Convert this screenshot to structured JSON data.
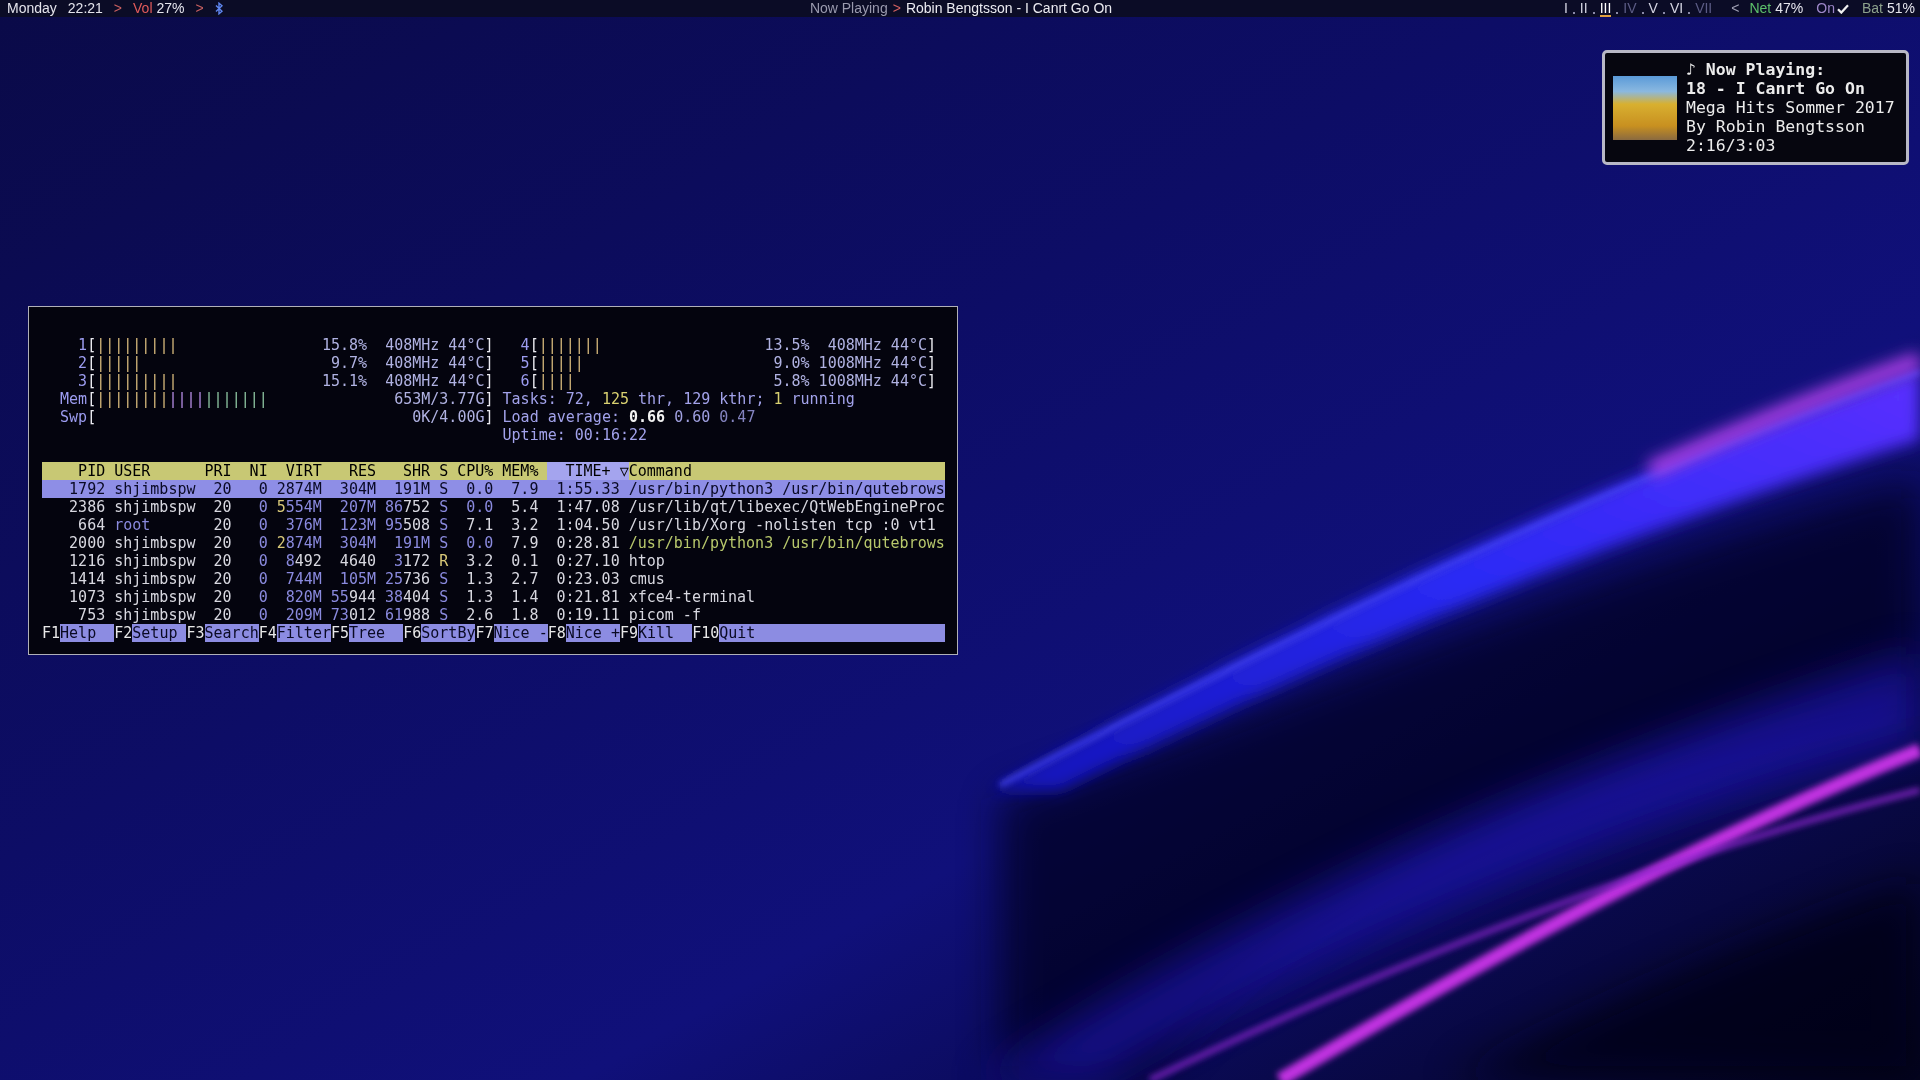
{
  "top_bar": {
    "left": [
      {
        "kind": "day",
        "text": "Monday"
      },
      {
        "kind": "clock",
        "text": "22:21"
      },
      {
        "kind": "separator",
        "text": ">",
        "color": "#c86060"
      },
      {
        "kind": "status",
        "label": "Vol",
        "value": "27%",
        "color": "#e05a5a"
      },
      {
        "kind": "separator",
        "text": ">",
        "color": "#c86060"
      },
      {
        "kind": "bluetooth"
      }
    ],
    "now_playing": {
      "label": "Now Playing",
      "separator": ">",
      "track": "Robin Bengtsson - I Canrt Go On"
    },
    "workspaces": [
      {
        "label": "I",
        "selected": false,
        "occupied": true
      },
      {
        "label": "II",
        "selected": false,
        "occupied": true
      },
      {
        "label": "III",
        "selected": true,
        "occupied": true
      },
      {
        "label": "IV",
        "selected": false,
        "occupied": false
      },
      {
        "label": "V",
        "selected": false,
        "occupied": true
      },
      {
        "label": "VI",
        "selected": false,
        "occupied": true
      },
      {
        "label": "VII",
        "selected": false,
        "occupied": false
      }
    ],
    "right": [
      {
        "kind": "separator",
        "text": "<",
        "color": "#a0a0b4"
      },
      {
        "kind": "status",
        "label": "Net",
        "value": "47%",
        "color": "#5cc06a"
      },
      {
        "kind": "check",
        "label": "On",
        "checked": true,
        "color": "#9c86c8"
      },
      {
        "kind": "status",
        "label": "Bat",
        "value": "51%",
        "color": "#8ca08c"
      }
    ]
  },
  "notification": {
    "heading": "♪ Now Playing:",
    "track": "18 - I Canrt Go On",
    "album": "Mega Hits Sommer 2017",
    "artist": "By Robin Bengtsson",
    "time": "2:16/3:03"
  },
  "htop": {
    "meters_left": [
      {
        "label": "1",
        "open": "[",
        "bars": [
          "|||||||||"
        ],
        "reading": "15.8%  408MHz 44°C",
        "close": "]"
      },
      {
        "label": "2",
        "open": "[",
        "bars": [
          "|||||"
        ],
        "reading": "9.7%  408MHz 44°C",
        "close": "]"
      },
      {
        "label": "3",
        "open": "[",
        "bars": [
          "|||||||||"
        ],
        "reading": "15.1%  408MHz 44°C",
        "close": "]"
      },
      {
        "label": "Mem",
        "open": "[",
        "bars": [
          "||||||||",
          "||||",
          "|||||||"
        ],
        "reading": "653M/3.77G",
        "close": "]"
      },
      {
        "label": "Swp",
        "open": "[",
        "reading": "0K/4.00G",
        "close": "]"
      }
    ],
    "meters_right": [
      {
        "label": "4",
        "open": "[",
        "bars": [
          "|||||||"
        ],
        "reading": "13.5%  408MHz 44°C",
        "close": "]"
      },
      {
        "label": "5",
        "open": "[",
        "bars": [
          "|||||"
        ],
        "reading": "9.0% 1008MHz 44°C",
        "close": "]"
      },
      {
        "label": "6",
        "open": "[",
        "bars": [
          "||||"
        ],
        "reading": "5.8% 1008MHz 44°C",
        "close": "]"
      }
    ],
    "info": [
      {
        "segments": [
          {
            "text": "Tasks: 72, ",
            "color": "#a2a2ea"
          },
          {
            "text": "125",
            "color": "#d8d070"
          },
          {
            "text": " thr, 129 kthr; ",
            "color": "#a2a2ea"
          },
          {
            "text": "1",
            "color": "#d8d070"
          },
          {
            "text": " running",
            "color": "#a2a2ea"
          }
        ]
      },
      {
        "segments": [
          {
            "text": "Load average: ",
            "color": "#a2a2ea"
          },
          {
            "text": "**0.66**",
            "color": "#f2f2f2"
          },
          {
            "text": " 0.60",
            "color": "#a0a0e0"
          },
          {
            "text": " 0.47",
            "color": "#8484c0"
          }
        ]
      },
      {
        "segments": [
          {
            "text": "Uptime: 00:16:22",
            "color": "#a2a2ea"
          }
        ]
      }
    ],
    "columns": [
      {
        "label": "PID",
        "selected": false
      },
      {
        "label": "USER",
        "selected": false
      },
      {
        "label": "PRI",
        "selected": false
      },
      {
        "label": "NI",
        "selected": false
      },
      {
        "label": "VIRT",
        "selected": false
      },
      {
        "label": "RES",
        "selected": false
      },
      {
        "label": "SHR",
        "selected": false
      },
      {
        "label": "S",
        "selected": false
      },
      {
        "label": "CPU%",
        "selected": false
      },
      {
        "label": "MEM%",
        "selected": false
      },
      {
        "label": "TIME+",
        "selected": true,
        "sort_arrow": "▽"
      },
      {
        "label": "Command",
        "selected": false
      }
    ],
    "rows": [
      {
        "selected": true,
        "cells": [
          {
            "text": "1792"
          },
          {
            "text": "shjimbspw"
          },
          {
            "text": "20"
          },
          {
            "text": "0"
          },
          {
            "text": "2874M"
          },
          {
            "text": "304M"
          },
          {
            "text": "191M"
          },
          {
            "text": "S"
          },
          {
            "text": "0.0"
          },
          {
            "text": "7.9"
          },
          {
            "text": "1:55.33"
          },
          {
            "text": "/usr/bin/python3 /usr/bin/qutebrows"
          }
        ]
      },
      {
        "selected": false,
        "cells": [
          {
            "text": "2386"
          },
          {
            "text": "shjimbspw"
          },
          {
            "text": "20"
          },
          {
            "text": "0",
            "color": "#8a8ade"
          },
          {
            "parts": [
              {
                "text": "5",
                "color": "#d8c878"
              },
              {
                "text": "554M",
                "color": "#8a8ade"
              }
            ]
          },
          {
            "text": "207M",
            "color": "#8a8ade"
          },
          {
            "parts": [
              {
                "text": "86",
                "color": "#8a8ade"
              },
              {
                "text": "752",
                "color": "#d8d8e0"
              }
            ]
          },
          {
            "text": "S",
            "color": "#8a8ade"
          },
          {
            "text": "0.0",
            "color": "#8a8ade"
          },
          {
            "text": "5.4"
          },
          {
            "text": "1:47.08"
          },
          {
            "text": "/usr/lib/qt/libexec/QtWebEngineProc"
          }
        ]
      },
      {
        "selected": false,
        "cells": [
          {
            "text": "664"
          },
          {
            "text": "root",
            "color": "#8a8ade"
          },
          {
            "text": "20"
          },
          {
            "text": "0",
            "color": "#8a8ade"
          },
          {
            "text": "376M",
            "color": "#8a8ade"
          },
          {
            "text": "123M",
            "color": "#8a8ade"
          },
          {
            "parts": [
              {
                "text": "95",
                "color": "#8a8ade"
              },
              {
                "text": "508",
                "color": "#d8d8e0"
              }
            ]
          },
          {
            "text": "S",
            "color": "#8a8ade"
          },
          {
            "text": "7.1"
          },
          {
            "text": "3.2"
          },
          {
            "text": "1:04.50"
          },
          {
            "text": "/usr/lib/Xorg -nolisten tcp :0 vt1"
          }
        ]
      },
      {
        "selected": false,
        "cells": [
          {
            "text": "2000"
          },
          {
            "text": "shjimbspw"
          },
          {
            "text": "20"
          },
          {
            "text": "0",
            "color": "#8a8ade"
          },
          {
            "parts": [
              {
                "text": "2",
                "color": "#d8c878"
              },
              {
                "text": "874M",
                "color": "#8a8ade"
              }
            ]
          },
          {
            "text": "304M",
            "color": "#8a8ade"
          },
          {
            "text": "191M",
            "color": "#8a8ade"
          },
          {
            "text": "S",
            "color": "#8a8ade"
          },
          {
            "text": "0.0",
            "color": "#8a8ade"
          },
          {
            "text": "7.9"
          },
          {
            "text": "0:28.81"
          },
          {
            "text": "/usr/bin/python3 /usr/bin/qutebrows",
            "color": "#b8c86c"
          }
        ]
      },
      {
        "selected": false,
        "cells": [
          {
            "text": "1216"
          },
          {
            "text": "shjimbspw"
          },
          {
            "text": "20"
          },
          {
            "text": "0",
            "color": "#8a8ade"
          },
          {
            "parts": [
              {
                "text": "8",
                "color": "#8a8ade"
              },
              {
                "text": "492",
                "color": "#d8d8e0"
              }
            ]
          },
          {
            "text": "4640"
          },
          {
            "parts": [
              {
                "text": "3",
                "color": "#8a8ade"
              },
              {
                "text": "172",
                "color": "#d8d8e0"
              }
            ]
          },
          {
            "text": "R",
            "color": "#d8c878"
          },
          {
            "text": "3.2"
          },
          {
            "text": "0.1"
          },
          {
            "text": "0:27.10"
          },
          {
            "text": "htop"
          }
        ]
      },
      {
        "selected": false,
        "cells": [
          {
            "text": "1414"
          },
          {
            "text": "shjimbspw"
          },
          {
            "text": "20"
          },
          {
            "text": "0",
            "color": "#8a8ade"
          },
          {
            "text": "744M",
            "color": "#8a8ade"
          },
          {
            "text": "105M",
            "color": "#8a8ade"
          },
          {
            "parts": [
              {
                "text": "25",
                "color": "#8a8ade"
              },
              {
                "text": "736",
                "color": "#d8d8e0"
              }
            ]
          },
          {
            "text": "S",
            "color": "#8a8ade"
          },
          {
            "text": "1.3"
          },
          {
            "text": "2.7"
          },
          {
            "text": "0:23.03"
          },
          {
            "text": "cmus"
          }
        ]
      },
      {
        "selected": false,
        "cells": [
          {
            "text": "1073"
          },
          {
            "text": "shjimbspw"
          },
          {
            "text": "20"
          },
          {
            "text": "0",
            "color": "#8a8ade"
          },
          {
            "text": "820M",
            "color": "#8a8ade"
          },
          {
            "parts": [
              {
                "text": "55",
                "color": "#8a8ade"
              },
              {
                "text": "944",
                "color": "#d8d8e0"
              }
            ]
          },
          {
            "parts": [
              {
                "text": "38",
                "color": "#8a8ade"
              },
              {
                "text": "404",
                "color": "#d8d8e0"
              }
            ]
          },
          {
            "text": "S",
            "color": "#8a8ade"
          },
          {
            "text": "1.3"
          },
          {
            "text": "1.4"
          },
          {
            "text": "0:21.81"
          },
          {
            "text": "xfce4-terminal"
          }
        ]
      },
      {
        "selected": false,
        "cells": [
          {
            "text": "753"
          },
          {
            "text": "shjimbspw"
          },
          {
            "text": "20"
          },
          {
            "text": "0",
            "color": "#8a8ade"
          },
          {
            "text": "209M",
            "color": "#8a8ade"
          },
          {
            "parts": [
              {
                "text": "73",
                "color": "#8a8ade"
              },
              {
                "text": "012",
                "color": "#d8d8e0"
              }
            ]
          },
          {
            "parts": [
              {
                "text": "61",
                "color": "#8a8ade"
              },
              {
                "text": "988",
                "color": "#d8d8e0"
              }
            ]
          },
          {
            "text": "S",
            "color": "#8a8ade"
          },
          {
            "text": "2.6"
          },
          {
            "text": "1.8"
          },
          {
            "text": "0:19.11"
          },
          {
            "text": "picom -f"
          }
        ]
      }
    ],
    "function_keys": [
      {
        "key": "F1",
        "label": "Help"
      },
      {
        "key": "F2",
        "label": "Setup"
      },
      {
        "key": "F3",
        "label": "Search"
      },
      {
        "key": "F4",
        "label": "Filter"
      },
      {
        "key": "F5",
        "label": "Tree"
      },
      {
        "key": "F6",
        "label": "SortBy"
      },
      {
        "key": "F7",
        "label": "Nice -"
      },
      {
        "key": "F8",
        "label": "Nice +"
      },
      {
        "key": "F9",
        "label": "Kill"
      },
      {
        "key": "F10",
        "label": "Quit"
      }
    ]
  }
}
